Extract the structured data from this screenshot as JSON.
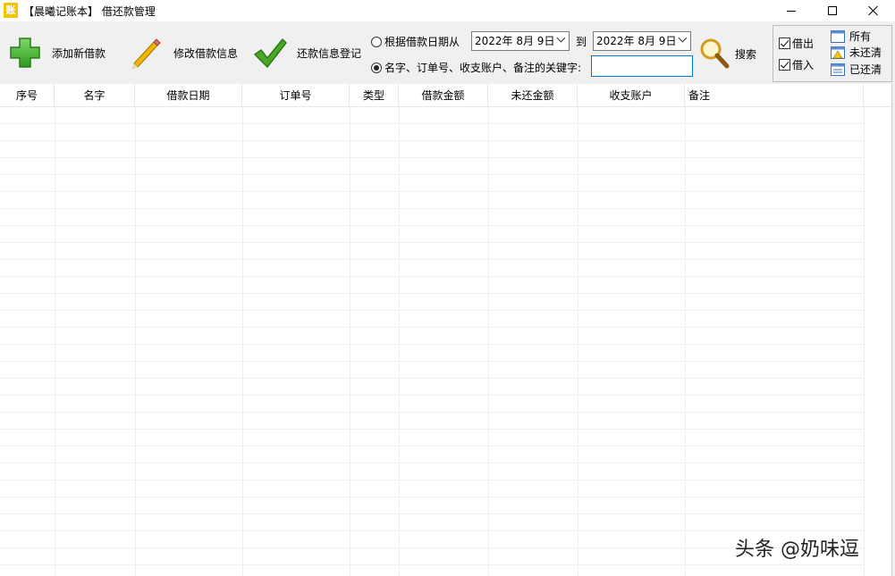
{
  "window": {
    "title": "【晨曦记账本】 借还款管理",
    "icon_char": "账",
    "icon_color": "#f3c400"
  },
  "toolbar": {
    "add_label": "添加新借款",
    "edit_label": "修改借款信息",
    "repay_label": "还款信息登记",
    "search_label": "搜索"
  },
  "filters": {
    "by_date_label": "根据借款日期从",
    "date_from": "2022年  8月  9日",
    "to_label": "到",
    "date_to": "2022年  8月  9日",
    "by_keyword_label": "名字、订单号、收支账户、备注的关键字:",
    "keyword_value": "",
    "selected_radio": "keyword"
  },
  "type_filter": {
    "lend_label": "借出",
    "lend_checked": true,
    "borrow_label": "借入",
    "borrow_checked": true
  },
  "status_filter": {
    "all_label": "所有",
    "unpaid_label": "未还清",
    "paid_label": "已还清"
  },
  "table": {
    "columns": [
      "序号",
      "名字",
      "借款日期",
      "订单号",
      "类型",
      "借款金额",
      "未还金额",
      "收支账户",
      "备注"
    ],
    "rows": []
  },
  "watermark": "头条 @奶味逗",
  "colors": {
    "add_icon": "#3fae2a",
    "check_icon": "#3a9a1e",
    "grid_line": "#eef0ee",
    "toolbar_bg": "#f0f0f0",
    "input_focus": "#0078d7"
  }
}
